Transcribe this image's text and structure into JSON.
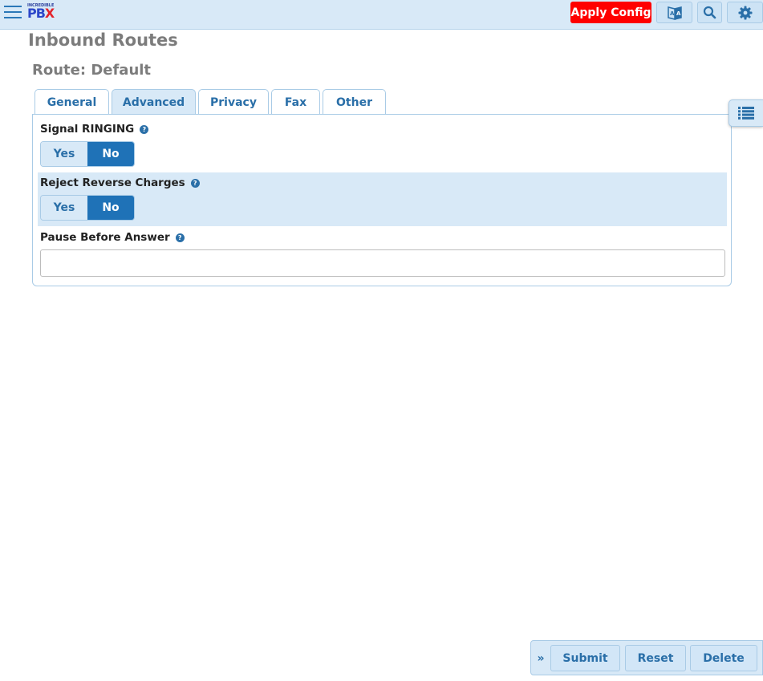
{
  "header": {
    "logo_small": "INCREDIBLE",
    "logo_big": "PB",
    "logo_x": "X",
    "apply_label": "Apply Config",
    "apply_color": "#ff0000",
    "icons": [
      "menu-icon",
      "language-icon",
      "search-icon",
      "gear-icon"
    ]
  },
  "page": {
    "title": "Inbound Routes",
    "route_title": "Route: Default"
  },
  "tabs": [
    {
      "label": "General",
      "active": false
    },
    {
      "label": "Advanced",
      "active": true
    },
    {
      "label": "Privacy",
      "active": false
    },
    {
      "label": "Fax",
      "active": false
    },
    {
      "label": "Other",
      "active": false
    }
  ],
  "fields": {
    "signal_ringing": {
      "label": "Signal RINGING",
      "help": "?",
      "yes": "Yes",
      "no": "No",
      "selected": "No"
    },
    "reject_reverse": {
      "label": "Reject Reverse Charges",
      "help": "?",
      "yes": "Yes",
      "no": "No",
      "selected": "No"
    },
    "pause_before_answer": {
      "label": "Pause Before Answer",
      "help": "?",
      "value": "",
      "placeholder": ""
    }
  },
  "actions": {
    "collapse": "»",
    "submit": "Submit",
    "reset": "Reset",
    "delete": "Delete"
  },
  "colors": {
    "accent": "#1f72b7",
    "header_bg": "#d8e9f7",
    "title_gray": "#7c7c7c"
  }
}
